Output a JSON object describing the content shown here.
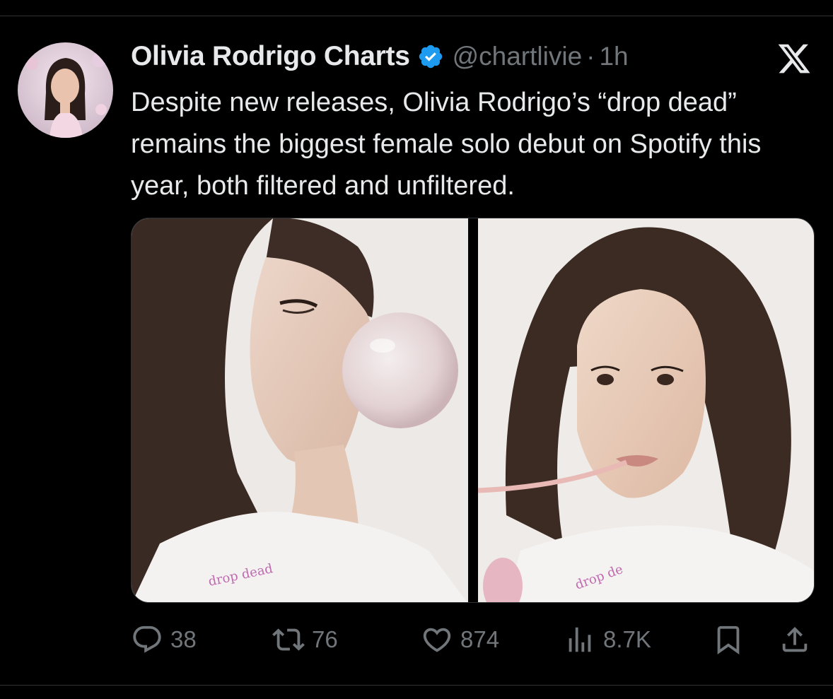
{
  "tweet": {
    "display_name": "Olivia Rodrigo Charts",
    "handle": "@chartlivie",
    "separator": "·",
    "time": "1h",
    "text": "Despite new releases, Olivia Rodrigo’s “drop dead” remains the biggest female solo debut on Spotify this year, both filtered and unfiltered."
  },
  "media": [
    {
      "icon": "photo-woman-blowing-bubblegum"
    },
    {
      "icon": "photo-woman-holding-gum"
    }
  ],
  "actions": {
    "replies": "38",
    "reposts": "76",
    "likes": "874",
    "views": "8.7K"
  },
  "icons": {
    "verified": "verified-badge-icon",
    "logo": "x-logo-icon",
    "reply": "reply-icon",
    "repost": "repost-icon",
    "like": "heart-icon",
    "views": "views-icon",
    "bookmark": "bookmark-icon",
    "share": "share-icon"
  },
  "colors": {
    "background": "#000000",
    "text": "#e7e9ea",
    "muted": "#71767b",
    "verified": "#1d9bf0"
  }
}
